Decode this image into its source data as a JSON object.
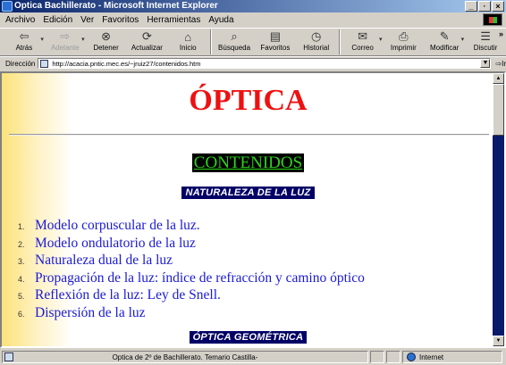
{
  "window": {
    "title": "Optica Bachillerato - Microsoft Internet Explorer",
    "buttons": [
      "_",
      "·",
      "×"
    ]
  },
  "menu": [
    "Archivo",
    "Edición",
    "Ver",
    "Favoritos",
    "Herramientas",
    "Ayuda"
  ],
  "toolbar": {
    "back": "Atrás",
    "forward": "Adelante",
    "stop": "Detener",
    "refresh": "Actualizar",
    "home": "Inicio",
    "search": "Búsqueda",
    "favorites": "Favoritos",
    "history": "Historial",
    "mail": "Correo",
    "print": "Imprimir",
    "edit": "Modificar",
    "discuss": "Discutir",
    "more": "»"
  },
  "address": {
    "label": "Dirección",
    "url": "http://acacia.pntic.mec.es/~jruiz27/contenidos.htm",
    "go": "Ir"
  },
  "page": {
    "title": "ÓPTICA",
    "contents_heading": "CONTENIDOS",
    "section1": "NATURALEZA DE LA LUZ",
    "topics": [
      {
        "num": "1.",
        "text": "Modelo corpuscular de la luz."
      },
      {
        "num": "2.",
        "text": "Modelo ondulatorio de  la luz"
      },
      {
        "num": "3.",
        "text": "Naturaleza dual de la luz"
      },
      {
        "num": "4.",
        "text": "Propagación de la luz: índice de refracción y camino óptico"
      },
      {
        "num": "5.",
        "text": "Reflexión de la luz: Ley de Snell."
      },
      {
        "num": "6.",
        "text": "Dispersión de la luz"
      }
    ],
    "section2": "ÓPTICA GEOMÉTRICA"
  },
  "status": {
    "text": "Optica de 2º de Bachillerato. Temario Castilla-",
    "zone": "Internet"
  },
  "colors": {
    "title_red": "#ee1111",
    "link_blue": "#1a1ad6",
    "contents_green": "#2cd41a",
    "section_navy": "#000066"
  }
}
